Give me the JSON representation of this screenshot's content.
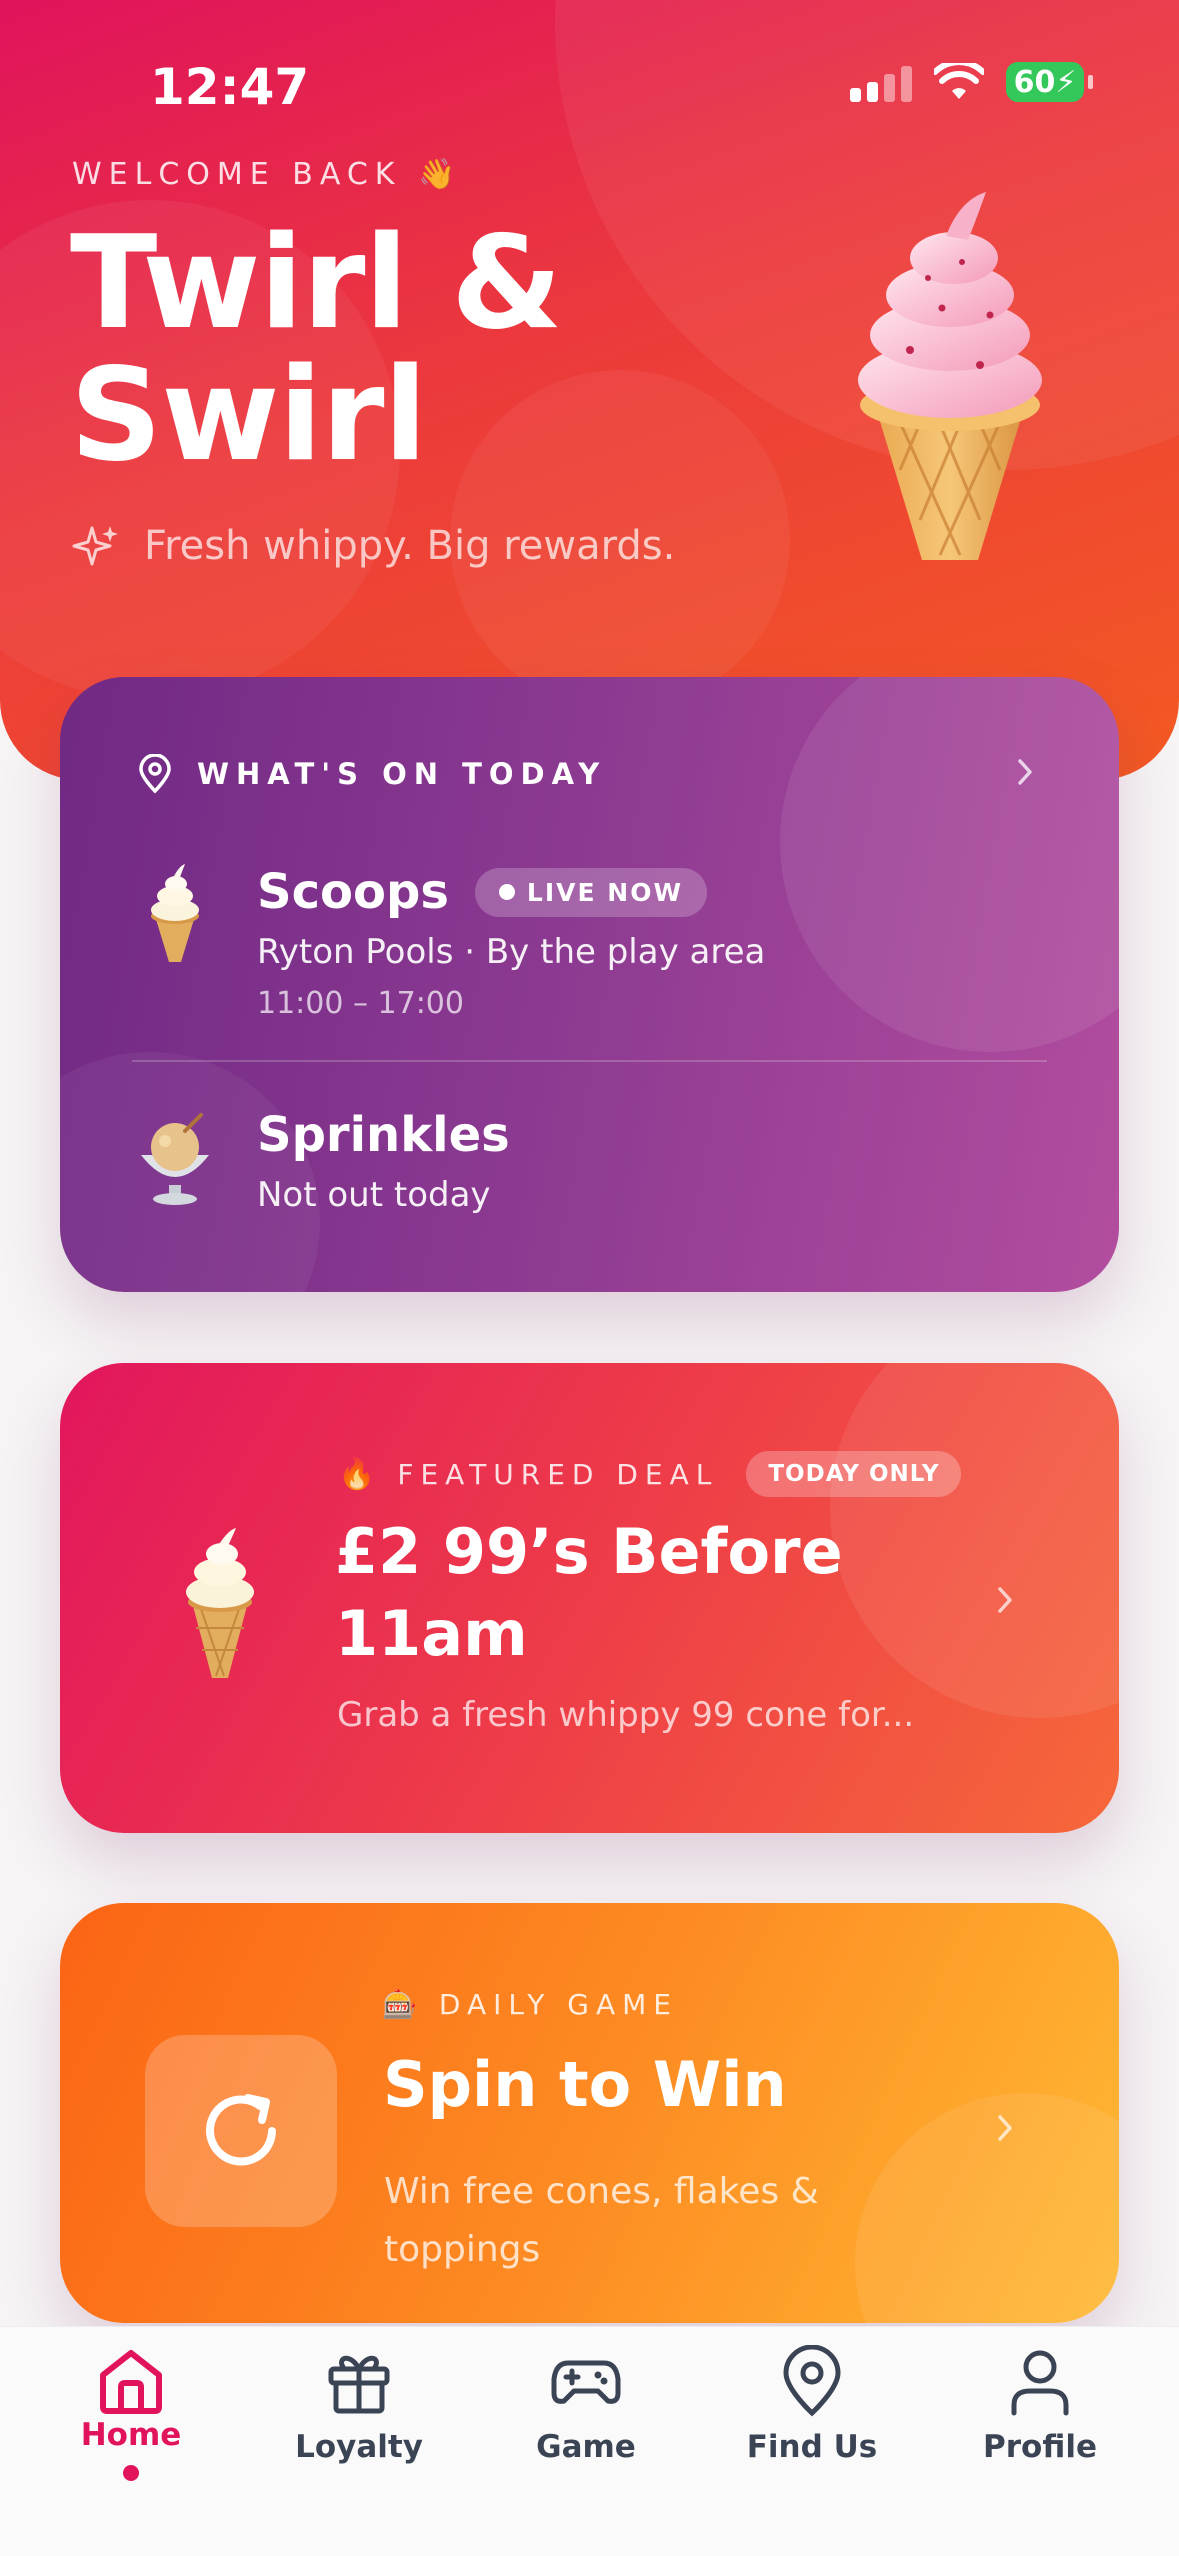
{
  "status_bar": {
    "time": "12:47",
    "battery": "60"
  },
  "hero": {
    "welcome": "WELCOME BACK 👋",
    "brand": "Twirl & Swirl",
    "tagline": "Fresh whippy. Big rewards."
  },
  "whats_on": {
    "heading": "WHAT'S ON TODAY",
    "vans": [
      {
        "name": "Scoops",
        "badge": "LIVE NOW",
        "location": "Ryton Pools · By the play area",
        "hours": "11:00 – 17:00"
      },
      {
        "name": "Sprinkles",
        "location": "Not out today"
      }
    ]
  },
  "featured_deal": {
    "icon": "🔥",
    "label": "FEATURED DEAL",
    "badge": "TODAY ONLY",
    "title": "£2 99’s Before 11am",
    "description": "Grab a fresh whippy 99 cone for..."
  },
  "daily_game": {
    "icon": "🎰",
    "label": "DAILY GAME",
    "title": "Spin to Win",
    "description": "Win free cones, flakes & toppings"
  },
  "tabs": [
    {
      "label": "Home",
      "icon": "home-icon",
      "active": true
    },
    {
      "label": "Loyalty",
      "icon": "gift-icon"
    },
    {
      "label": "Game",
      "icon": "gamepad-icon"
    },
    {
      "label": "Find Us",
      "icon": "map-pin-icon"
    },
    {
      "label": "Profile",
      "icon": "user-icon"
    }
  ],
  "colors": {
    "brand_pink": "#e0135c",
    "deal_orange": "#f6683a",
    "game_orange": "#fd8a22",
    "today_purple": "#8e3b92",
    "tab_inactive": "#3b4454"
  }
}
